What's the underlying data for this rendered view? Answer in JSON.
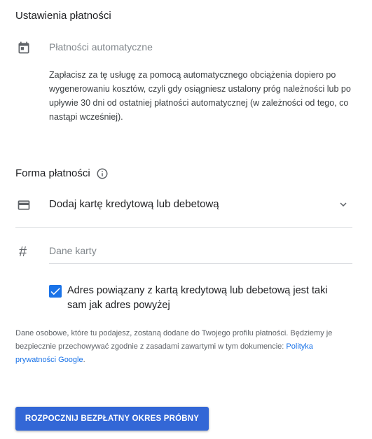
{
  "payment_settings": {
    "title": "Ustawienia płatności",
    "calendar_icon": "calendar-icon",
    "auto_payments_label": "Płatności automatyczne",
    "auto_payments_description": "Zapłacisz za tę usługę za pomocą automatycznego obciążenia dopiero po wygenerowaniu kosztów, czyli gdy osiągniesz ustalony próg należności lub po upływie 30 dni od ostatniej płatności automatycznej (w zależności od tego, co nastąpi wcześniej)."
  },
  "payment_method": {
    "title": "Forma płatności",
    "info_icon": "info-icon",
    "card_icon": "credit-card-icon",
    "add_card_label": "Dodaj kartę kredytową lub debetową",
    "chevron_icon": "chevron-down-icon",
    "hash_icon_glyph": "#",
    "card_data_placeholder": "Dane karty",
    "same_address_checked": true,
    "same_address_label": "Adres powiązany z kartą kredytową lub debetową jest taki sam jak adres powyżej"
  },
  "privacy": {
    "note_text": "Dane osobowe, które tu podajesz, zostaną dodane do Twojego profilu płatności. Będziemy je bezpiecznie przechowywać zgodnie z zasadami zawartymi w tym dokumencie: ",
    "link_text": "Polityka prywatności Google",
    "suffix": "."
  },
  "cta": {
    "label": "ROZPOCZNIJ BEZPŁATNY OKRES PRÓBNY",
    "color": "#3367d6"
  },
  "colors": {
    "accent": "#1a73e8",
    "link": "#1a73e8",
    "divider": "#dadce0"
  }
}
